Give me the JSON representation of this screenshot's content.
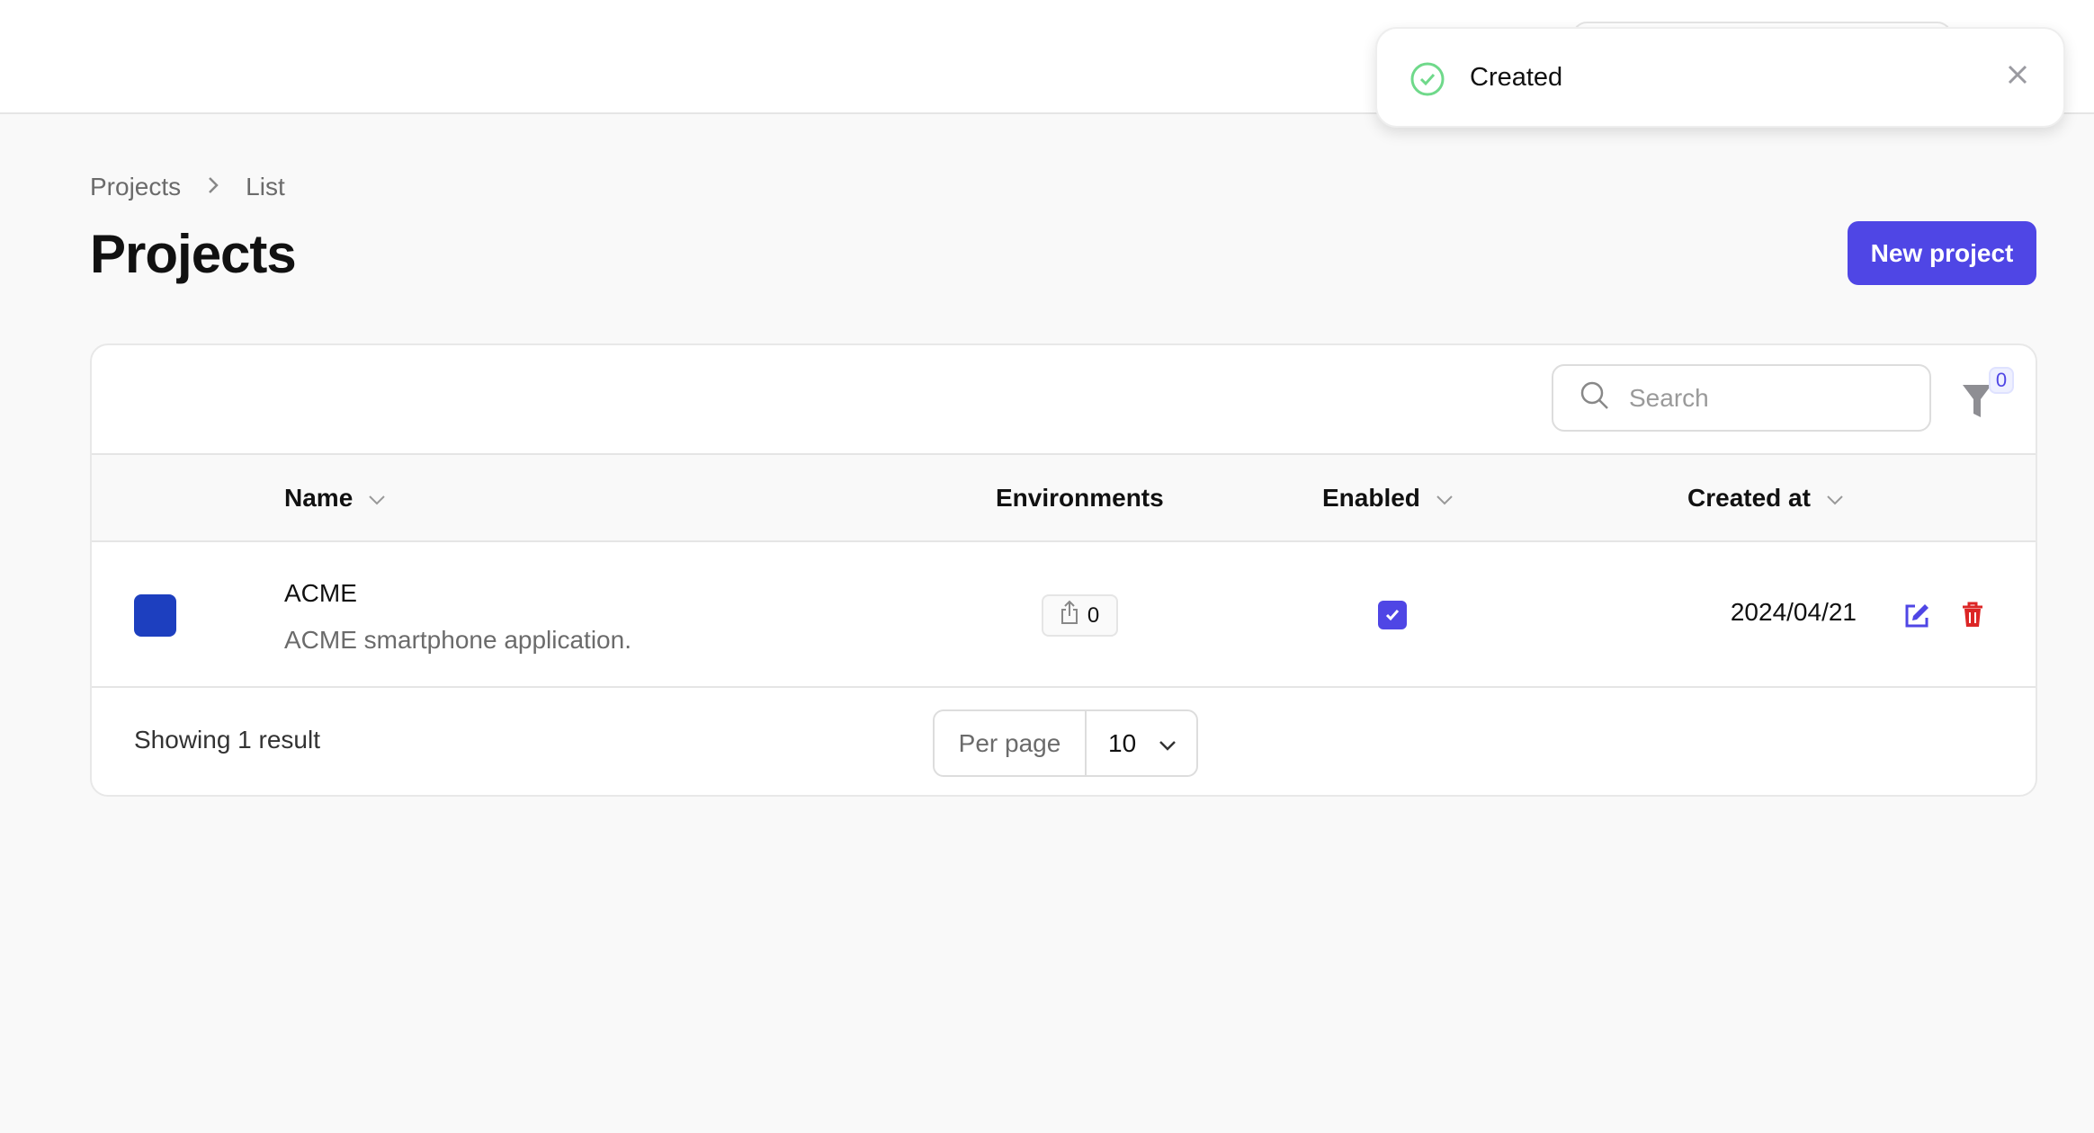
{
  "toast": {
    "message": "Created",
    "status_color": "#6fd98a"
  },
  "breadcrumb": [
    "Projects",
    "List"
  ],
  "page_title": "Projects",
  "new_project_label": "New project",
  "accent_color": "#4f46e5",
  "toolbar": {
    "search_placeholder": "Search",
    "search_value": "",
    "filter_count": "0"
  },
  "table": {
    "columns": [
      "Name",
      "Environments",
      "Enabled",
      "Created at"
    ],
    "rows": [
      {
        "color": "#1d3fbf",
        "name": "ACME",
        "description": "ACME smartphone application.",
        "environments": "0",
        "enabled": true,
        "created_at": "2024/04/21"
      }
    ]
  },
  "footer": {
    "showing": "Showing 1 result",
    "per_page_label": "Per page",
    "per_page_value": "10"
  }
}
